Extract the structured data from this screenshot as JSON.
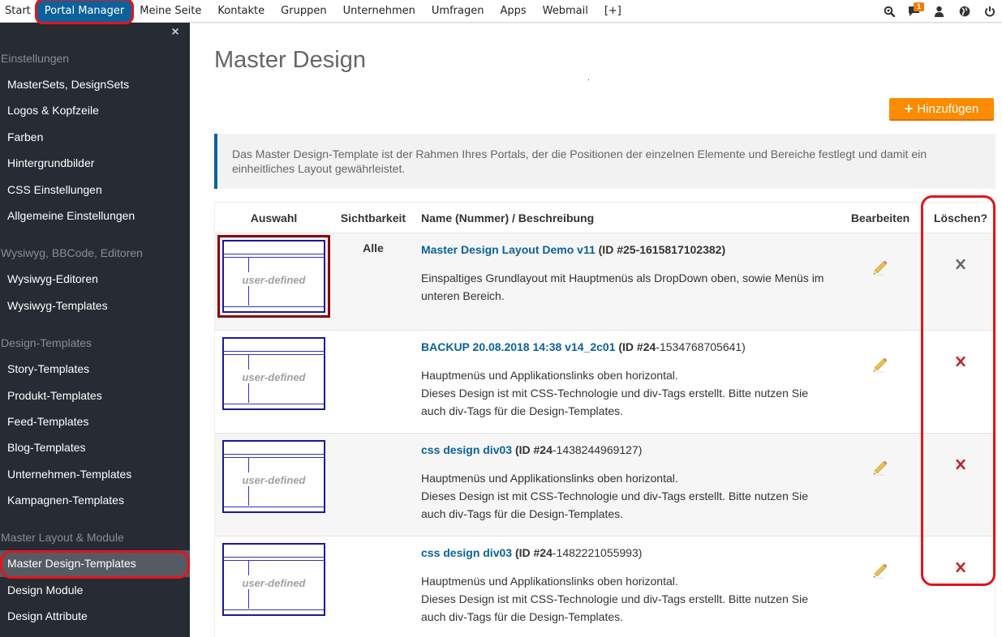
{
  "topnav": {
    "items": [
      {
        "label": "Start",
        "active": false
      },
      {
        "label": "Portal Manager",
        "active": true
      },
      {
        "label": "Meine Seite",
        "active": false
      },
      {
        "label": "Kontakte",
        "active": false
      },
      {
        "label": "Gruppen",
        "active": false
      },
      {
        "label": "Unternehmen",
        "active": false
      },
      {
        "label": "Umfragen",
        "active": false
      },
      {
        "label": "Apps",
        "active": false
      },
      {
        "label": "Webmail",
        "active": false
      },
      {
        "label": "[+]",
        "active": false
      }
    ],
    "icons": [
      "search-icon",
      "messages-icon",
      "user-icon",
      "globe-icon",
      "power-icon"
    ],
    "message_badge": "1"
  },
  "sidebar": {
    "close_label": "×",
    "groups": [
      {
        "title": "Einstellungen",
        "items": [
          "MasterSets, DesignSets",
          "Logos & Kopfzeile",
          "Farben",
          "Hintergrundbilder",
          "CSS Einstellungen",
          "Allgemeine Einstellungen"
        ]
      },
      {
        "title": "Wysiwyg, BBCode, Editoren",
        "items": [
          "Wysiwyg-Editoren",
          "Wysiwyg-Templates"
        ]
      },
      {
        "title": "Design-Templates",
        "items": [
          "Story-Templates",
          "Produkt-Templates",
          "Feed-Templates",
          "Blog-Templates",
          "Unternehmen-Templates",
          "Kampagnen-Templates"
        ]
      },
      {
        "title": "Master Layout & Module",
        "items": [
          "Master Design-Templates",
          "Design Module",
          "Design Attribute"
        ]
      }
    ],
    "active_item": "Master Design-Templates"
  },
  "main": {
    "title": "Master Design",
    "add_button": "Hinzufügen",
    "info_text": "Das Master Design-Template ist der Rahmen Ihres Portals, der die Positionen der einzelnen Elemente und Bereiche festlegt und damit ein einheitliches Layout gewährleistet.",
    "table": {
      "headers": {
        "select": "Auswahl",
        "visibility": "Sichtbarkeit",
        "name": "Name (Nummer) / Beschreibung",
        "edit": "Bearbeiten",
        "delete": "Löschen?"
      },
      "thumb_label": "user-defined",
      "rows": [
        {
          "selected": true,
          "visibility": "Alle",
          "name": "Master Design Layout Demo v11",
          "id_prefix": "(ID #25",
          "id_suffix": "-1615817102382)",
          "id_suffix_bold": true,
          "description": [
            "Einspaltiges Grundlayout mit Hauptmenüs als DropDown oben, sowie Menüs im unteren Bereich."
          ],
          "delete_enabled": false
        },
        {
          "selected": false,
          "visibility": "",
          "name": "BACKUP 20.08.2018 14:38 v14_2c01",
          "id_prefix": "(ID #24",
          "id_suffix": "-1534768705641)",
          "id_suffix_bold": false,
          "description": [
            "Hauptmenüs und Applikationslinks oben horizontal.",
            "Dieses Design ist mit CSS-Technologie und div-Tags erstellt. Bitte nutzen Sie auch div-Tags für die Design-Templates."
          ],
          "delete_enabled": true
        },
        {
          "selected": false,
          "visibility": "",
          "name": "css design div03",
          "id_prefix": "(ID #24",
          "id_suffix": "-1438244969127)",
          "id_suffix_bold": false,
          "description": [
            "Hauptmenüs und Applikationslinks oben horizontal.",
            "Dieses Design ist mit CSS-Technologie und div-Tags erstellt. Bitte nutzen Sie auch div-Tags für die Design-Templates."
          ],
          "delete_enabled": true
        },
        {
          "selected": false,
          "visibility": "",
          "name": "css design div03",
          "id_prefix": "(ID #24",
          "id_suffix": "-1482221055993)",
          "id_suffix_bold": false,
          "description": [
            "Hauptmenüs und Applikationslinks oben horizontal.",
            "Dieses Design ist mit CSS-Technologie und div-Tags erstellt. Bitte nutzen Sie auch div-Tags für die Design-Templates."
          ],
          "delete_enabled": true
        }
      ]
    }
  },
  "colors": {
    "accent_blue": "#0b629b",
    "orange": "#fb8c00",
    "sidebar_bg": "#272b33",
    "annotation_red": "#e3141c",
    "delete_red": "#c0272d"
  }
}
